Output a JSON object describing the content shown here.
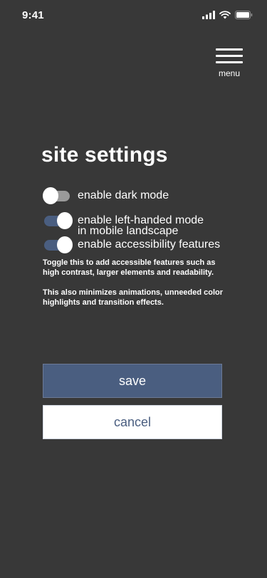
{
  "status_bar": {
    "time": "9:41"
  },
  "icons": {
    "signal": "cellular-signal-icon",
    "wifi": "wifi-icon",
    "battery": "battery-icon",
    "menu": "hamburger-menu-icon"
  },
  "header": {
    "menu_label": "menu"
  },
  "page": {
    "title": "site settings"
  },
  "settings": {
    "dark_mode": {
      "label": "enable dark mode",
      "enabled": false
    },
    "left_handed": {
      "label_line1": "enable left-handed mode",
      "label_line2": "in mobile landscape",
      "enabled": true
    },
    "accessibility": {
      "label": "enable accessibility features",
      "enabled": true
    }
  },
  "help": {
    "paragraph1": "Toggle this to add accessible features such as high contrast, larger elements and readability.",
    "paragraph2": "This also minimizes animations, unneeded color highlights and transition effects."
  },
  "actions": {
    "save_label": "save",
    "cancel_label": "cancel"
  },
  "colors": {
    "background": "#383838",
    "accent": "#4a5e80",
    "toggle_off_track": "#9a9a9a",
    "text": "#ffffff"
  }
}
